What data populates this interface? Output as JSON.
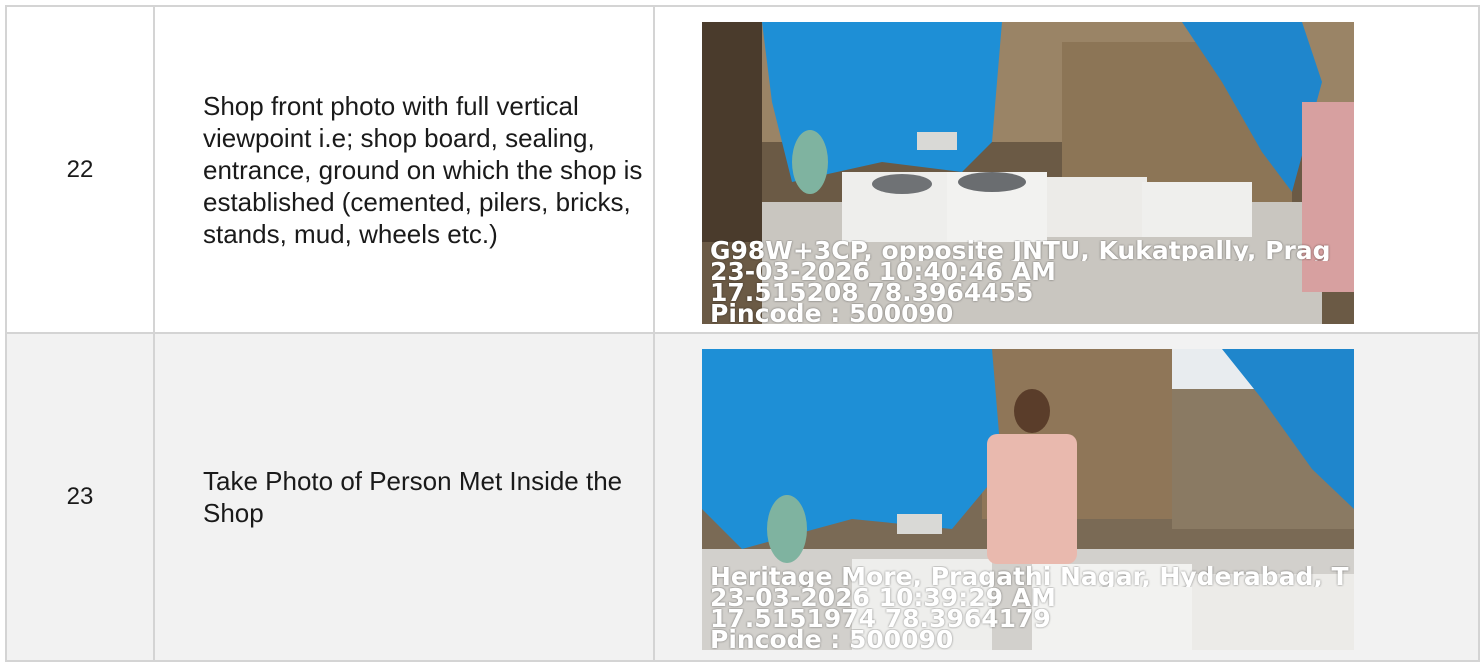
{
  "rows": [
    {
      "number": "22",
      "description": "Shop front photo with full vertical viewpoint i.e; shop board, sealing, entrance, ground on which the shop is established (cemented, pilers, bricks, stands, mud, wheels etc.)",
      "photo": {
        "address": "G98W+3CP, opposite JNTU, Kukatpally, Prag",
        "datetime": "23-03-2026 10:40:46 AM",
        "coords": "17.515208 78.3964455",
        "pincode": "Pincode : 500090"
      }
    },
    {
      "number": "23",
      "description": "Take Photo of Person Met Inside the Shop",
      "photo": {
        "address": "Heritage More, Pragathi Nagar, Hyderabad, T",
        "datetime": "23-03-2026 10:39:29 AM",
        "coords": "17.5151974 78.3964179",
        "pincode": "Pincode : 500090"
      }
    }
  ],
  "colors": {
    "tarp_blue": "#1e8fd6",
    "border": "#d4d4d4",
    "alt_row": "#f2f2f2"
  }
}
